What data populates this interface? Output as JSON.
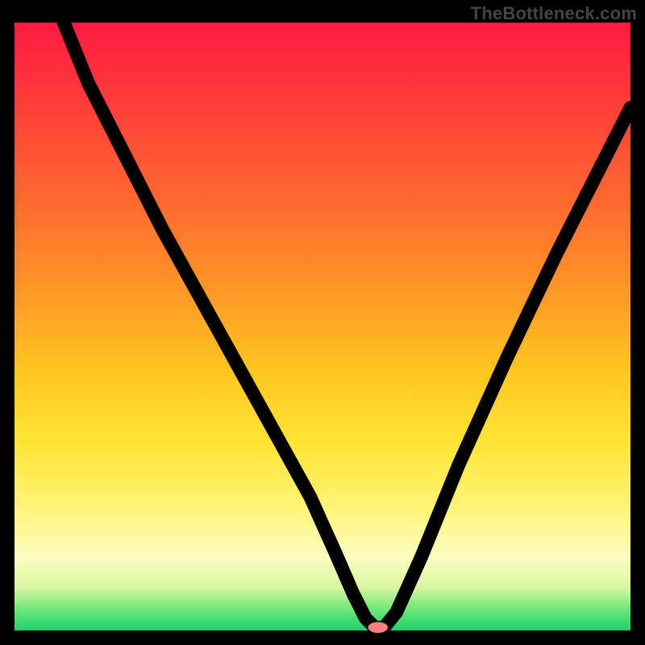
{
  "brand": "TheBottleneck.com",
  "chart_data": {
    "type": "line",
    "title": "",
    "xlabel": "",
    "ylabel": "",
    "xlim": [
      0,
      100
    ],
    "ylim": [
      0,
      100
    ],
    "grid": false,
    "legend": false,
    "series": [
      {
        "name": "bottleneck-curve",
        "x": [
          8,
          12,
          18,
          24,
          30,
          36,
          42,
          48,
          52,
          55,
          57,
          58.5,
          60,
          62,
          66,
          72,
          80,
          88,
          96,
          100
        ],
        "y": [
          100,
          90,
          78,
          66,
          55,
          44,
          33,
          22,
          13,
          6,
          2,
          0.5,
          0.5,
          3,
          12,
          27,
          45,
          62,
          78,
          86
        ]
      }
    ],
    "marker": {
      "x": 59,
      "y": 0.5,
      "rx": 1.6,
      "ry": 0.9,
      "color": "#ff7f7f"
    },
    "gradient_stops": [
      {
        "pos": 0,
        "color": "#ff1a43"
      },
      {
        "pos": 12,
        "color": "#ff3a3a"
      },
      {
        "pos": 30,
        "color": "#ff6a2f"
      },
      {
        "pos": 45,
        "color": "#ff9a26"
      },
      {
        "pos": 58,
        "color": "#ffc81f"
      },
      {
        "pos": 70,
        "color": "#ffe63a"
      },
      {
        "pos": 80,
        "color": "#fff47a"
      },
      {
        "pos": 88,
        "color": "#fcfcc0"
      },
      {
        "pos": 93,
        "color": "#d6f7a0"
      },
      {
        "pos": 96,
        "color": "#7de97e"
      },
      {
        "pos": 100,
        "color": "#18d46a"
      }
    ]
  }
}
